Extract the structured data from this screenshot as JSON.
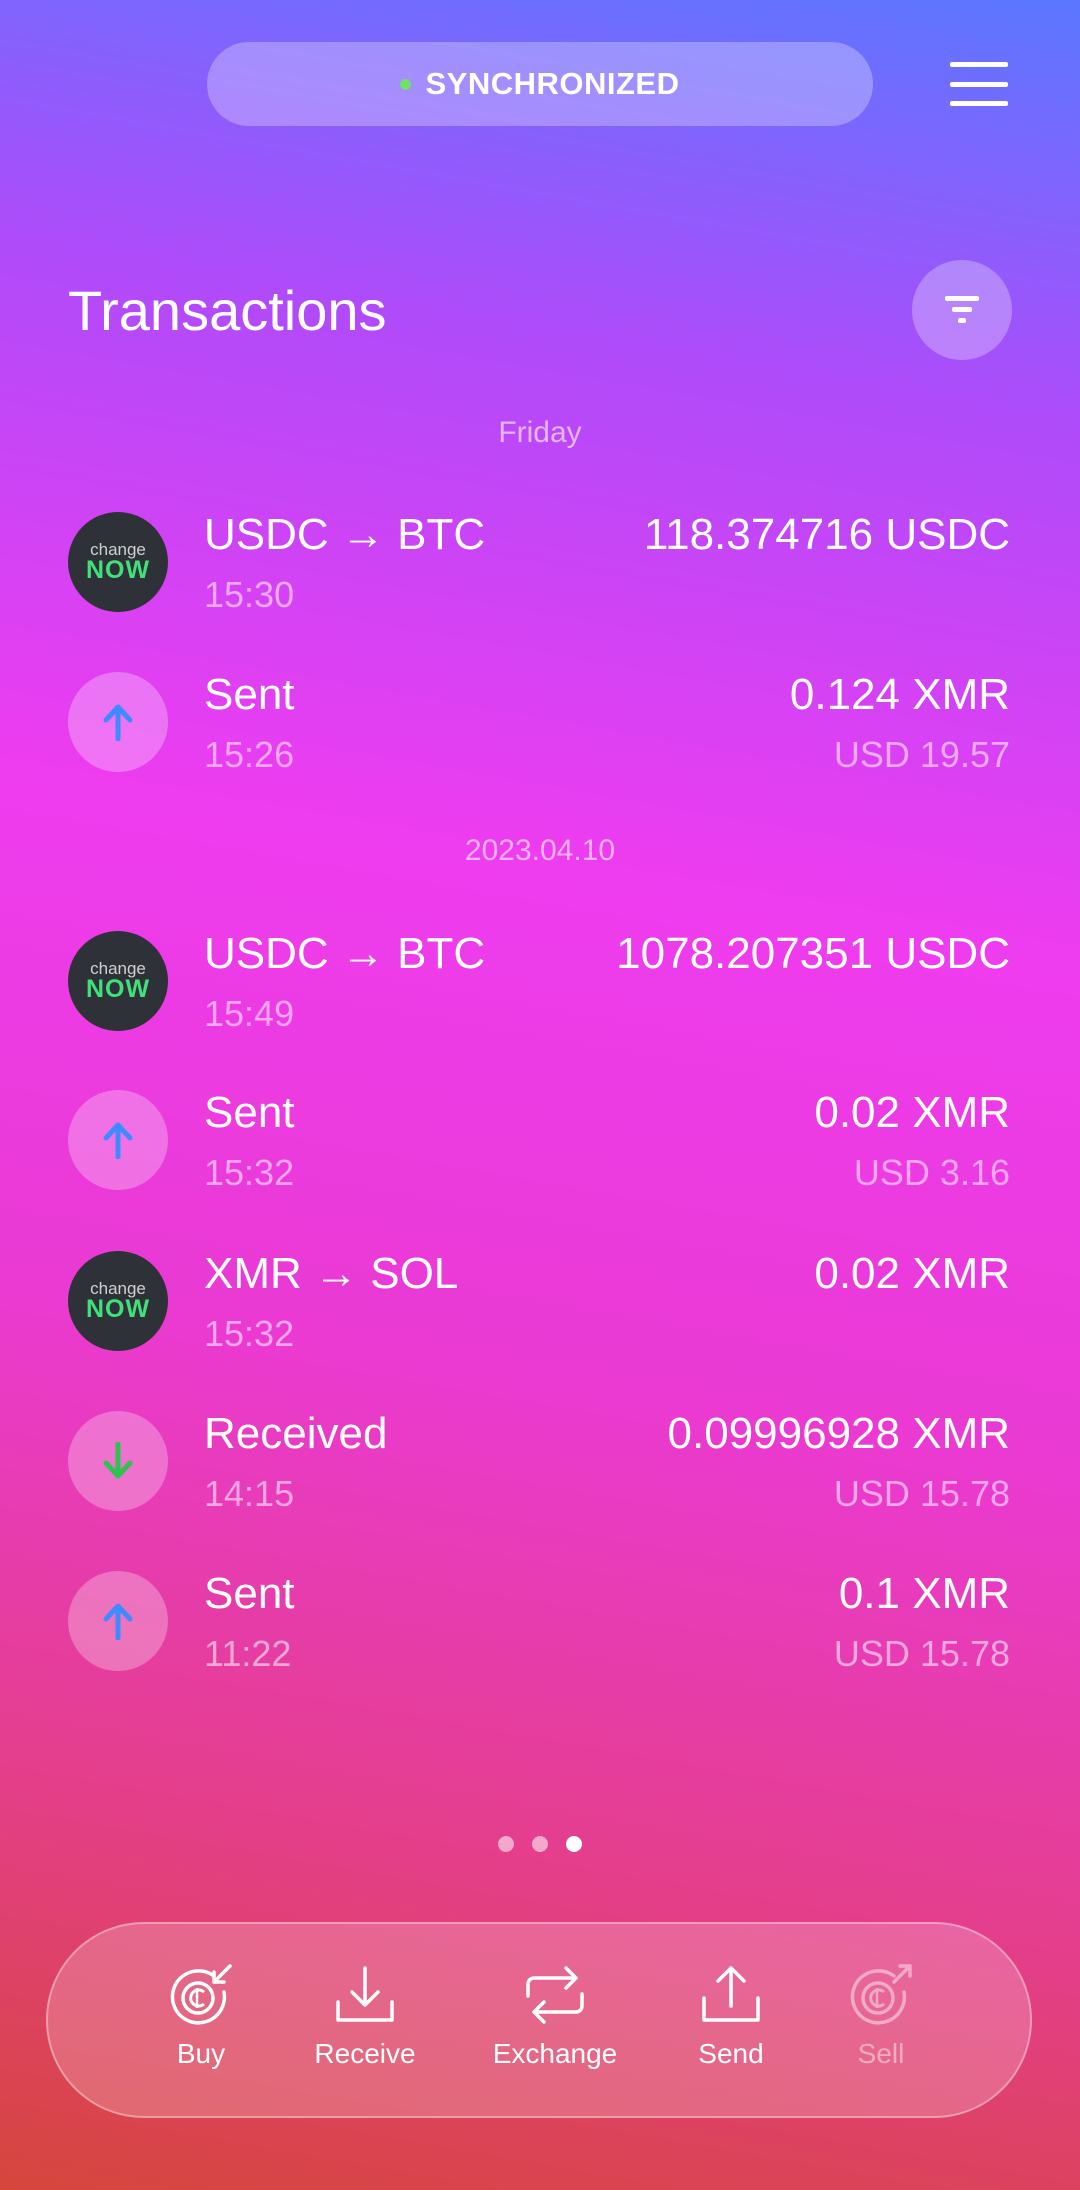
{
  "header": {
    "status": "SYNCHRONIZED",
    "status_color": "#6fe06a"
  },
  "title": "Transactions",
  "groups": [
    {
      "date": "Friday",
      "items": [
        {
          "icon": "changenow-logo",
          "name": "USDC → BTC",
          "time": "15:30",
          "amount": "118.374716 USDC",
          "fiat": ""
        },
        {
          "icon": "arrow-up-icon",
          "name": "Sent",
          "time": "15:26",
          "amount": "0.124 XMR",
          "fiat": "USD 19.57"
        }
      ]
    },
    {
      "date": "2023.04.10",
      "items": [
        {
          "icon": "changenow-logo",
          "name": "USDC → BTC",
          "time": "15:49",
          "amount": "1078.207351 USDC",
          "fiat": ""
        },
        {
          "icon": "arrow-up-icon",
          "name": "Sent",
          "time": "15:32",
          "amount": "0.02 XMR",
          "fiat": "USD 3.16"
        },
        {
          "icon": "changenow-logo",
          "name": "XMR → SOL",
          "time": "15:32",
          "amount": "0.02 XMR",
          "fiat": ""
        },
        {
          "icon": "arrow-down-icon",
          "name": "Received",
          "time": "14:15",
          "amount": "0.09996928 XMR",
          "fiat": "USD 15.78"
        },
        {
          "icon": "arrow-up-icon",
          "name": "Sent",
          "time": "11:22",
          "amount": "0.1 XMR",
          "fiat": "USD 15.78"
        }
      ]
    }
  ],
  "changenow": {
    "top": "change",
    "bottom": "NOW"
  },
  "pager": {
    "count": 3,
    "active": 3
  },
  "actions": {
    "buy": "Buy",
    "receive": "Receive",
    "exchange": "Exchange",
    "send": "Send",
    "sell": "Sell"
  },
  "colors": {
    "sent_arrow": "#3d8bff",
    "received_arrow": "#2ec24f",
    "changenow_green": "#41e07a"
  }
}
